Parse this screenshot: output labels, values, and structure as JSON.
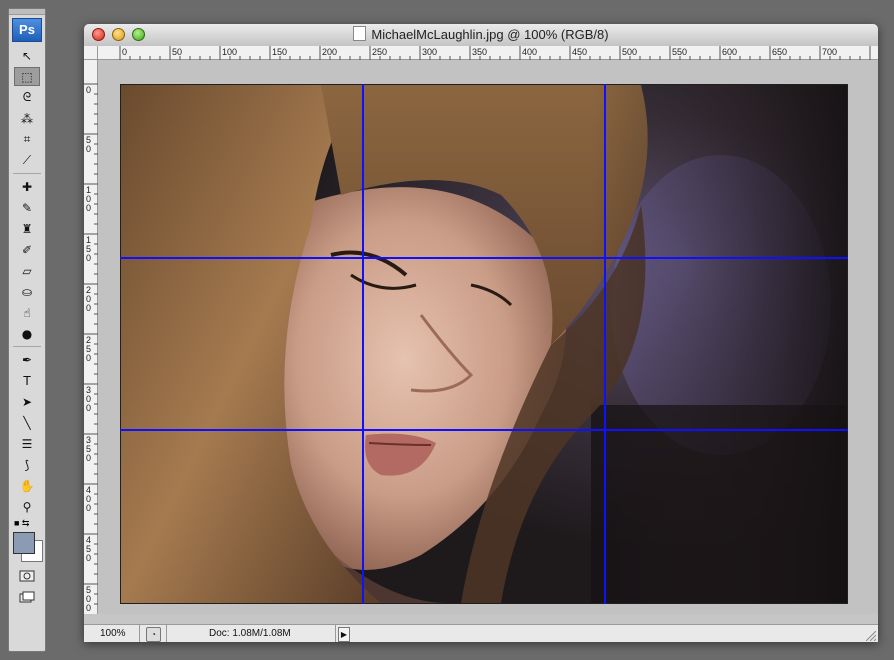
{
  "app": {
    "logo": "Ps"
  },
  "document": {
    "filename": "MichaelMcLaughlin.jpg",
    "title_suffix": "@ 100% (RGB/8)",
    "window_title": "MichaelMcLaughlin.jpg @ 100% (RGB/8)"
  },
  "rulers": {
    "horizontal_labels": [
      "0",
      "50",
      "100",
      "150",
      "200",
      "250",
      "300",
      "350",
      "400",
      "450",
      "500",
      "550",
      "600",
      "650",
      "700"
    ],
    "vertical_labels": [
      "0",
      "5 0",
      "1 0 0",
      "1 5 0",
      "2 0 0",
      "2 5 0",
      "3 0 0",
      "3 5 0",
      "4 0 0",
      "4 5 0",
      "5 0 0"
    ]
  },
  "toolbox": {
    "tools": [
      {
        "name": "move-tool",
        "glyph": "↖"
      },
      {
        "name": "marquee-tool",
        "glyph": "⬚",
        "active": true
      },
      {
        "name": "lasso-tool",
        "glyph": "ᘓ"
      },
      {
        "name": "magic-wand-tool",
        "glyph": "⁂"
      },
      {
        "name": "crop-tool",
        "glyph": "⌗"
      },
      {
        "name": "slice-tool",
        "glyph": "⟋"
      },
      {
        "name": "healing-brush-tool",
        "glyph": "✚"
      },
      {
        "name": "brush-tool",
        "glyph": "✎"
      },
      {
        "name": "clone-stamp-tool",
        "glyph": "♜"
      },
      {
        "name": "history-brush-tool",
        "glyph": "✐"
      },
      {
        "name": "eraser-tool",
        "glyph": "▱"
      },
      {
        "name": "paint-bucket-tool",
        "glyph": "⛀"
      },
      {
        "name": "smudge-tool",
        "glyph": "☝"
      },
      {
        "name": "dodge-tool",
        "glyph": "●"
      },
      {
        "name": "pen-tool",
        "glyph": "✒"
      },
      {
        "name": "type-tool",
        "glyph": "T"
      },
      {
        "name": "path-selection-tool",
        "glyph": "➤"
      },
      {
        "name": "line-tool",
        "glyph": "╲"
      },
      {
        "name": "notes-tool",
        "glyph": "☰"
      },
      {
        "name": "eyedropper-tool",
        "glyph": "⟆"
      },
      {
        "name": "hand-tool",
        "glyph": "✋"
      },
      {
        "name": "zoom-tool",
        "glyph": "⚲"
      }
    ],
    "swatch_icons": "■ ⇆",
    "mode_icons": [
      "quick-mask-icon",
      "screen-mode-icon"
    ],
    "colors": {
      "foreground": "#8a9bb3",
      "background": "#ffffff"
    }
  },
  "statusbar": {
    "zoom": "100%",
    "doc_info": "Doc: 1.08M/1.08M",
    "arrow": "▶"
  },
  "guides": {
    "vertical_fraction": [
      0.333,
      0.665
    ],
    "horizontal_fraction": [
      0.333,
      0.663
    ],
    "color": "#1010ff"
  }
}
